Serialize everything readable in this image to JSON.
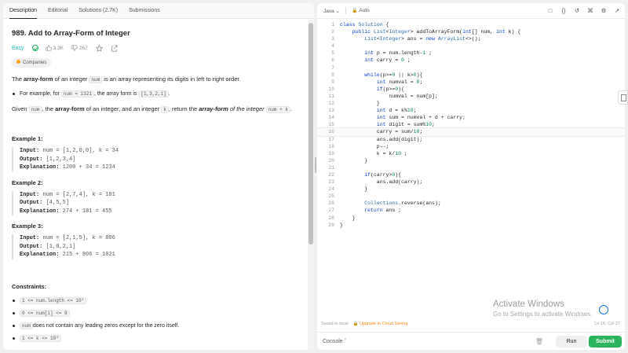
{
  "tabs": [
    "Description",
    "Editorial",
    "Solutions (2.7K)",
    "Submissions"
  ],
  "problem": {
    "title": "989. Add to Array-Form of Integer",
    "difficulty": "Easy",
    "likes": "3.3K",
    "dislikes": "267",
    "companies": "Companies",
    "intro_1": "The ",
    "intro_bold": "array-form",
    "intro_2": " of an integer ",
    "intro_code": "num",
    "intro_3": " is an array representing its digits in left to right order.",
    "bullet_1": "For example, for ",
    "bullet_code1": "num = 1321",
    "bullet_2": ", the array form is ",
    "bullet_code2": "[1,3,2,1]",
    "bullet_3": ".",
    "given_1": "Given ",
    "given_code1": "num",
    "given_2": ", the ",
    "given_bold": "array-form",
    "given_3": " of an integer, and an integer ",
    "given_code2": "k",
    "given_4": ", return the ",
    "given_bold2": "array-form",
    "given_5": " of the integer ",
    "given_code3": "num + k",
    "given_6": "."
  },
  "examples": [
    {
      "title": "Example 1:",
      "input": "num = [1,2,0,0], k = 34",
      "output": "[1,2,3,4]",
      "explanation": "1200 + 34 = 1234"
    },
    {
      "title": "Example 2:",
      "input": "num = [2,7,4], k = 181",
      "output": "[4,5,5]",
      "explanation": "274 + 181 = 455"
    },
    {
      "title": "Example 3:",
      "input": "num = [2,1,5], k = 806",
      "output": "[1,0,2,1]",
      "explanation": "215 + 806 = 1021"
    }
  ],
  "labels": {
    "input": "Input:",
    "output": "Output:",
    "explanation": "Explanation:"
  },
  "constraints": {
    "title": "Constraints:",
    "c1": "1 <= num.length <= 10⁴",
    "c2": "0 <= num[i] <= 9",
    "c3_code": "num",
    "c3_text": " does not contain any leading zeros except for the zero itself.",
    "c4_code": "1 <= k <= 10⁴"
  },
  "editor": {
    "language": "Java",
    "mode": "Auto",
    "saved": "Saved to local",
    "upgrade": "Upgrade to Cloud Saving",
    "position": "Ln 16, Col 27",
    "console": "Console",
    "run": "Run",
    "submit": "Submit"
  },
  "code_lines": [
    "class Solution {",
    "    public List<Integer> addToArrayForm(int[] num, int k) {",
    "        List<Integer> ans = new ArrayList<>();",
    "",
    "        int p = num.length-1 ;",
    "        int carry = 0 ;",
    "",
    "        while(p>=0 || k>0){",
    "            int numval = 0;",
    "            if(p>=0){",
    "                numval = num[p];",
    "            }",
    "            int d = k%10;",
    "            int sum = numval + d + carry;",
    "            int digit = sum%10;",
    "            carry = sum/10;",
    "            ans.add(digit);",
    "            p--;",
    "            k = k/10 ;",
    "        }",
    "",
    "        if(carry>0){",
    "            ans.add(carry);",
    "        }",
    "",
    "        Collections.reverse(ans);",
    "        return ans ;",
    "    }",
    "}"
  ],
  "current_line": 16,
  "watermark": {
    "title": "Activate Windows",
    "sub": "Go to Settings to activate Windows."
  },
  "colors": {
    "easy": "#1cb8b8",
    "submit": "#2db55d",
    "accent": "#ffa116",
    "keyword": "#0b40e0"
  }
}
